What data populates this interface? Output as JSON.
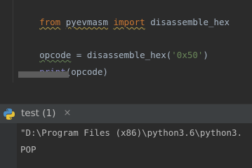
{
  "editor": {
    "line1": {
      "kw_from": "from",
      "module": "pyevmasm",
      "kw_import": "import",
      "name": "disassemble_hex"
    },
    "line2": {
      "var": "opcode",
      "op": " = ",
      "call": "disassemble_hex(",
      "arg": "'0x50'",
      "close": ")"
    },
    "line3": {
      "builtin": "print",
      "rest": "(opcode)"
    }
  },
  "run_panel": {
    "tab_label": "test (1)",
    "close_glyph": "×"
  },
  "console": {
    "command": "\"D:\\Program Files (x86)\\python3.6\\python3.",
    "output": "POP"
  }
}
